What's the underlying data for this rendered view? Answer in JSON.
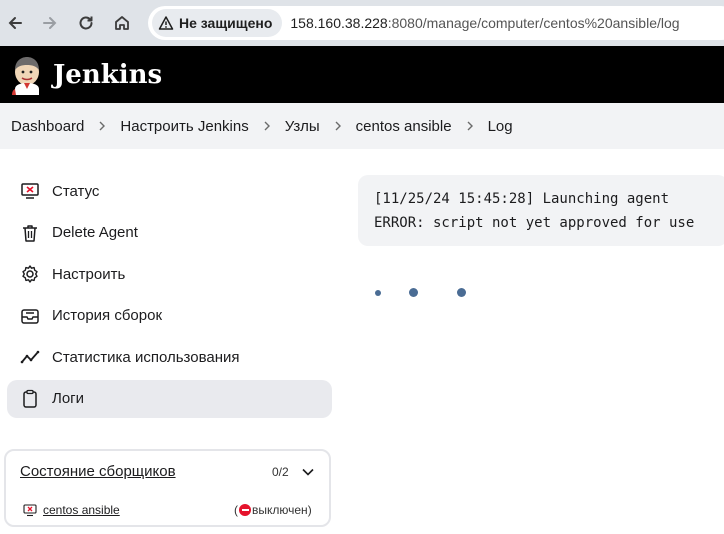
{
  "browser": {
    "back_icon": "arrow-left-icon",
    "forward_icon": "arrow-right-icon",
    "reload_icon": "reload-icon",
    "home_icon": "home-icon",
    "security_label": "Не защищено",
    "url_host": "158.160.38.228",
    "url_rest": ":8080/manage/computer/centos%20ansible/log"
  },
  "header": {
    "title": "Jenkins"
  },
  "breadcrumbs": [
    {
      "label": "Dashboard"
    },
    {
      "label": "Настроить Jenkins"
    },
    {
      "label": "Узлы"
    },
    {
      "label": "centos ansible"
    },
    {
      "label": "Log"
    }
  ],
  "sidebar": {
    "items": [
      {
        "label": "Статус",
        "icon": "computer-error-icon"
      },
      {
        "label": "Delete Agent",
        "icon": "trash-icon"
      },
      {
        "label": "Настроить",
        "icon": "gear-icon"
      },
      {
        "label": "История сборок",
        "icon": "inbox-icon"
      },
      {
        "label": "Статистика использования",
        "icon": "trend-icon"
      },
      {
        "label": "Логи",
        "icon": "clipboard-icon",
        "active": true
      }
    ]
  },
  "executors": {
    "title": "Состояние сборщиков",
    "count": "0/2",
    "node_name": "centos ansible",
    "node_status": "выключен",
    "status_open": "(",
    "status_close": ")"
  },
  "log": {
    "lines": "[11/25/24 15:45:28] Launching agent\nERROR: script not yet approved for use"
  },
  "colors": {
    "header_bg": "#000000",
    "breadcrumb_bg": "#f2f3f5",
    "active_item_bg": "#e9eaee",
    "spinner": "#4a6c94",
    "offline_red": "#e5132c"
  }
}
